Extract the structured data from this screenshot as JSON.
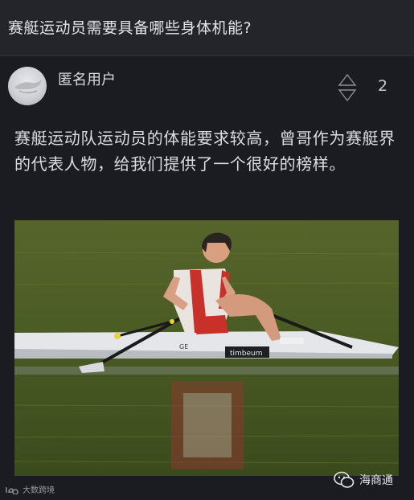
{
  "question": {
    "title": "赛艇运动员需要具备哪些身体机能?"
  },
  "answer": {
    "username": "匿名用户",
    "vote_count": "2",
    "text": "赛艇运动队运动员的体能要求较高，曾哥作为赛艇界的代表人物，给我们提供了一个很好的榜样。",
    "avatar_icon": "anonymous-avatar-icon",
    "vote_icon": "up-down-vote-icon"
  },
  "photo": {
    "boat_brand": "timbeum",
    "boat_number": "GE"
  },
  "footer": {
    "logo_text": "大数跨境",
    "watermark": "海商通"
  },
  "colors": {
    "background": "#1b1c22",
    "question_bar": "#23252b",
    "text": "#dcdce1"
  }
}
